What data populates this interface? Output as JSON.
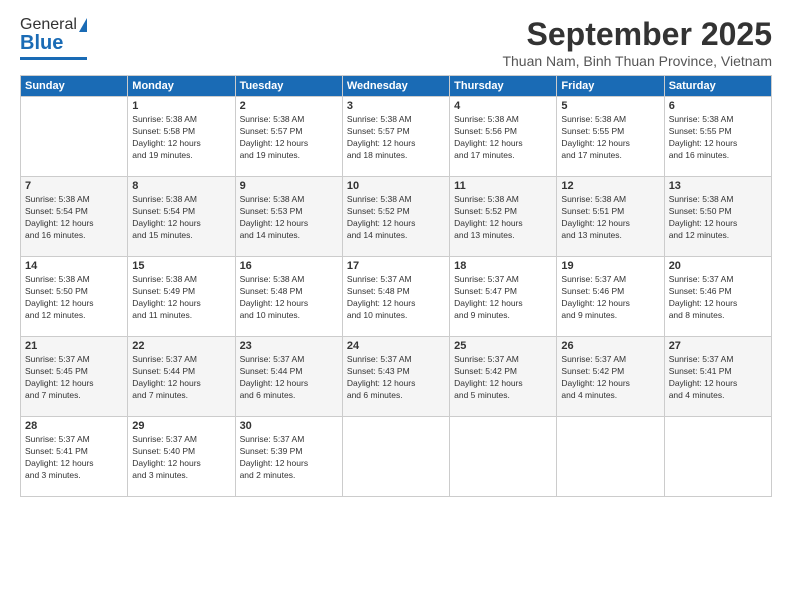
{
  "logo": {
    "general": "General",
    "blue": "Blue"
  },
  "header": {
    "title": "September 2025",
    "subtitle": "Thuan Nam, Binh Thuan Province, Vietnam"
  },
  "weekdays": [
    "Sunday",
    "Monday",
    "Tuesday",
    "Wednesday",
    "Thursday",
    "Friday",
    "Saturday"
  ],
  "weeks": [
    [
      {
        "day": "",
        "info": ""
      },
      {
        "day": "1",
        "info": "Sunrise: 5:38 AM\nSunset: 5:58 PM\nDaylight: 12 hours\nand 19 minutes."
      },
      {
        "day": "2",
        "info": "Sunrise: 5:38 AM\nSunset: 5:57 PM\nDaylight: 12 hours\nand 19 minutes."
      },
      {
        "day": "3",
        "info": "Sunrise: 5:38 AM\nSunset: 5:57 PM\nDaylight: 12 hours\nand 18 minutes."
      },
      {
        "day": "4",
        "info": "Sunrise: 5:38 AM\nSunset: 5:56 PM\nDaylight: 12 hours\nand 17 minutes."
      },
      {
        "day": "5",
        "info": "Sunrise: 5:38 AM\nSunset: 5:55 PM\nDaylight: 12 hours\nand 17 minutes."
      },
      {
        "day": "6",
        "info": "Sunrise: 5:38 AM\nSunset: 5:55 PM\nDaylight: 12 hours\nand 16 minutes."
      }
    ],
    [
      {
        "day": "7",
        "info": "Sunrise: 5:38 AM\nSunset: 5:54 PM\nDaylight: 12 hours\nand 16 minutes."
      },
      {
        "day": "8",
        "info": "Sunrise: 5:38 AM\nSunset: 5:54 PM\nDaylight: 12 hours\nand 15 minutes."
      },
      {
        "day": "9",
        "info": "Sunrise: 5:38 AM\nSunset: 5:53 PM\nDaylight: 12 hours\nand 14 minutes."
      },
      {
        "day": "10",
        "info": "Sunrise: 5:38 AM\nSunset: 5:52 PM\nDaylight: 12 hours\nand 14 minutes."
      },
      {
        "day": "11",
        "info": "Sunrise: 5:38 AM\nSunset: 5:52 PM\nDaylight: 12 hours\nand 13 minutes."
      },
      {
        "day": "12",
        "info": "Sunrise: 5:38 AM\nSunset: 5:51 PM\nDaylight: 12 hours\nand 13 minutes."
      },
      {
        "day": "13",
        "info": "Sunrise: 5:38 AM\nSunset: 5:50 PM\nDaylight: 12 hours\nand 12 minutes."
      }
    ],
    [
      {
        "day": "14",
        "info": "Sunrise: 5:38 AM\nSunset: 5:50 PM\nDaylight: 12 hours\nand 12 minutes."
      },
      {
        "day": "15",
        "info": "Sunrise: 5:38 AM\nSunset: 5:49 PM\nDaylight: 12 hours\nand 11 minutes."
      },
      {
        "day": "16",
        "info": "Sunrise: 5:38 AM\nSunset: 5:48 PM\nDaylight: 12 hours\nand 10 minutes."
      },
      {
        "day": "17",
        "info": "Sunrise: 5:37 AM\nSunset: 5:48 PM\nDaylight: 12 hours\nand 10 minutes."
      },
      {
        "day": "18",
        "info": "Sunrise: 5:37 AM\nSunset: 5:47 PM\nDaylight: 12 hours\nand 9 minutes."
      },
      {
        "day": "19",
        "info": "Sunrise: 5:37 AM\nSunset: 5:46 PM\nDaylight: 12 hours\nand 9 minutes."
      },
      {
        "day": "20",
        "info": "Sunrise: 5:37 AM\nSunset: 5:46 PM\nDaylight: 12 hours\nand 8 minutes."
      }
    ],
    [
      {
        "day": "21",
        "info": "Sunrise: 5:37 AM\nSunset: 5:45 PM\nDaylight: 12 hours\nand 7 minutes."
      },
      {
        "day": "22",
        "info": "Sunrise: 5:37 AM\nSunset: 5:44 PM\nDaylight: 12 hours\nand 7 minutes."
      },
      {
        "day": "23",
        "info": "Sunrise: 5:37 AM\nSunset: 5:44 PM\nDaylight: 12 hours\nand 6 minutes."
      },
      {
        "day": "24",
        "info": "Sunrise: 5:37 AM\nSunset: 5:43 PM\nDaylight: 12 hours\nand 6 minutes."
      },
      {
        "day": "25",
        "info": "Sunrise: 5:37 AM\nSunset: 5:42 PM\nDaylight: 12 hours\nand 5 minutes."
      },
      {
        "day": "26",
        "info": "Sunrise: 5:37 AM\nSunset: 5:42 PM\nDaylight: 12 hours\nand 4 minutes."
      },
      {
        "day": "27",
        "info": "Sunrise: 5:37 AM\nSunset: 5:41 PM\nDaylight: 12 hours\nand 4 minutes."
      }
    ],
    [
      {
        "day": "28",
        "info": "Sunrise: 5:37 AM\nSunset: 5:41 PM\nDaylight: 12 hours\nand 3 minutes."
      },
      {
        "day": "29",
        "info": "Sunrise: 5:37 AM\nSunset: 5:40 PM\nDaylight: 12 hours\nand 3 minutes."
      },
      {
        "day": "30",
        "info": "Sunrise: 5:37 AM\nSunset: 5:39 PM\nDaylight: 12 hours\nand 2 minutes."
      },
      {
        "day": "",
        "info": ""
      },
      {
        "day": "",
        "info": ""
      },
      {
        "day": "",
        "info": ""
      },
      {
        "day": "",
        "info": ""
      }
    ]
  ]
}
